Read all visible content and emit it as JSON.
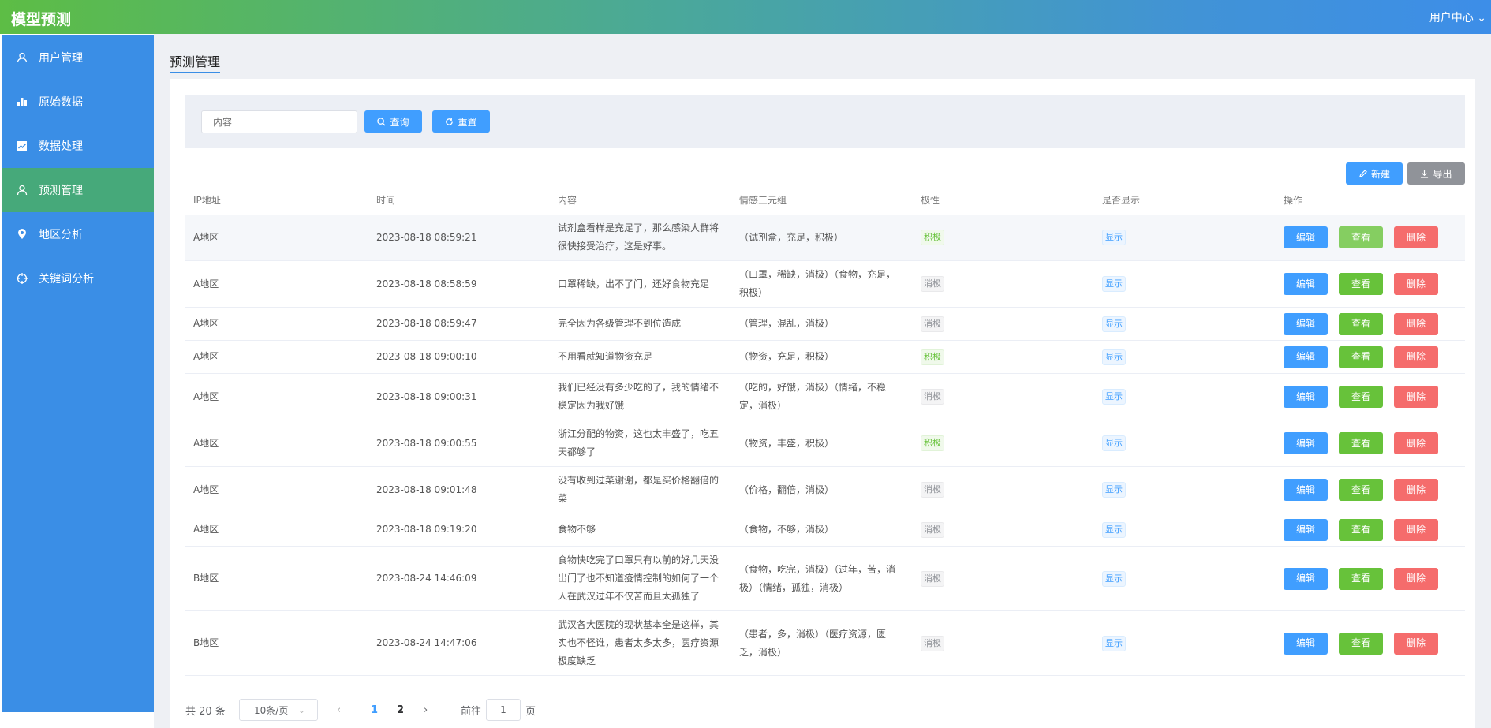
{
  "app": {
    "title": "模型预测",
    "user_menu": "用户中心"
  },
  "sidebar": {
    "items": [
      {
        "label": "用户管理",
        "icon": "user-icon"
      },
      {
        "label": "原始数据",
        "icon": "bar-chart-icon"
      },
      {
        "label": "数据处理",
        "icon": "trend-chart-icon"
      },
      {
        "label": "预测管理",
        "icon": "user-icon",
        "active": true
      },
      {
        "label": "地区分析",
        "icon": "location-icon"
      },
      {
        "label": "关键词分析",
        "icon": "aim-icon"
      }
    ]
  },
  "page": {
    "tab": "预测管理"
  },
  "search": {
    "placeholder": "内容",
    "query_label": "查询",
    "reset_label": "重置"
  },
  "toolbar": {
    "new_label": "新建",
    "export_label": "导出"
  },
  "table": {
    "columns": [
      "IP地址",
      "时间",
      "内容",
      "情感三元组",
      "极性",
      "是否显示",
      "操作"
    ],
    "rows": [
      {
        "ip": "A地区",
        "time": "2023-08-18 08:59:21",
        "content": "试剂盒看样是充足了，那么感染人群将很快接受治疗，这是好事。",
        "triple": "（试剂盒，充足，积极）",
        "polarity": "积极",
        "show": "显示"
      },
      {
        "ip": "A地区",
        "time": "2023-08-18 08:58:59",
        "content": "口罩稀缺，出不了门，还好食物充足",
        "triple": "（口罩，稀缺，消极）（食物，充足，积极）",
        "polarity": "消极",
        "show": "显示"
      },
      {
        "ip": "A地区",
        "time": "2023-08-18 08:59:47",
        "content": "完全因为各级管理不到位造成",
        "triple": "（管理，混乱，消极）",
        "polarity": "消极",
        "show": "显示"
      },
      {
        "ip": "A地区",
        "time": "2023-08-18 09:00:10",
        "content": "不用看就知道物资充足",
        "triple": "（物资，充足，积极）",
        "polarity": "积极",
        "show": "显示"
      },
      {
        "ip": "A地区",
        "time": "2023-08-18 09:00:31",
        "content": "我们已经没有多少吃的了，我的情绪不稳定因为我好饿",
        "triple": "（吃的，好饿，消极）（情绪，不稳定，消极）",
        "polarity": "消极",
        "show": "显示"
      },
      {
        "ip": "A地区",
        "time": "2023-08-18 09:00:55",
        "content": "浙江分配的物资，这也太丰盛了，吃五天都够了",
        "triple": "（物资，丰盛，积极）",
        "polarity": "积极",
        "show": "显示"
      },
      {
        "ip": "A地区",
        "time": "2023-08-18 09:01:48",
        "content": "没有收到过菜谢谢，都是买价格翻倍的菜",
        "triple": "（价格，翻倍，消极）",
        "polarity": "消极",
        "show": "显示"
      },
      {
        "ip": "A地区",
        "time": "2023-08-18 09:19:20",
        "content": "食物不够",
        "triple": "（食物，不够，消极）",
        "polarity": "消极",
        "show": "显示"
      },
      {
        "ip": "B地区",
        "time": "2023-08-24 14:46:09",
        "content": "食物快吃完了口罩只有以前的好几天没出门了也不知道疫情控制的如何了一个人在武汉过年不仅苦而且太孤独了",
        "triple": "（食物，吃完，消极）（过年，苦，消极）（情绪，孤独，消极）",
        "polarity": "消极",
        "show": "显示"
      },
      {
        "ip": "B地区",
        "time": "2023-08-24 14:47:06",
        "content": "武汉各大医院的现状基本全是这样，其实也不怪谁，患者太多太多，医疗资源极度缺乏",
        "triple": "（患者，多，消极）（医疗资源，匮乏，消极）",
        "polarity": "消极",
        "show": "显示"
      }
    ],
    "actions": {
      "edit": "编辑",
      "view": "查看",
      "delete": "删除"
    }
  },
  "pagination": {
    "total_text": "共 20 条",
    "page_size": "10条/页",
    "pages": [
      "1",
      "2"
    ],
    "current": "1",
    "goto_label": "前往",
    "goto_value": "1",
    "page_suffix": "页"
  },
  "colors": {
    "primary": "#409eff",
    "success": "#67c23a",
    "danger": "#f56c6c",
    "sidebar": "#3a8ee6",
    "sidebar_active": "#46a97a"
  }
}
